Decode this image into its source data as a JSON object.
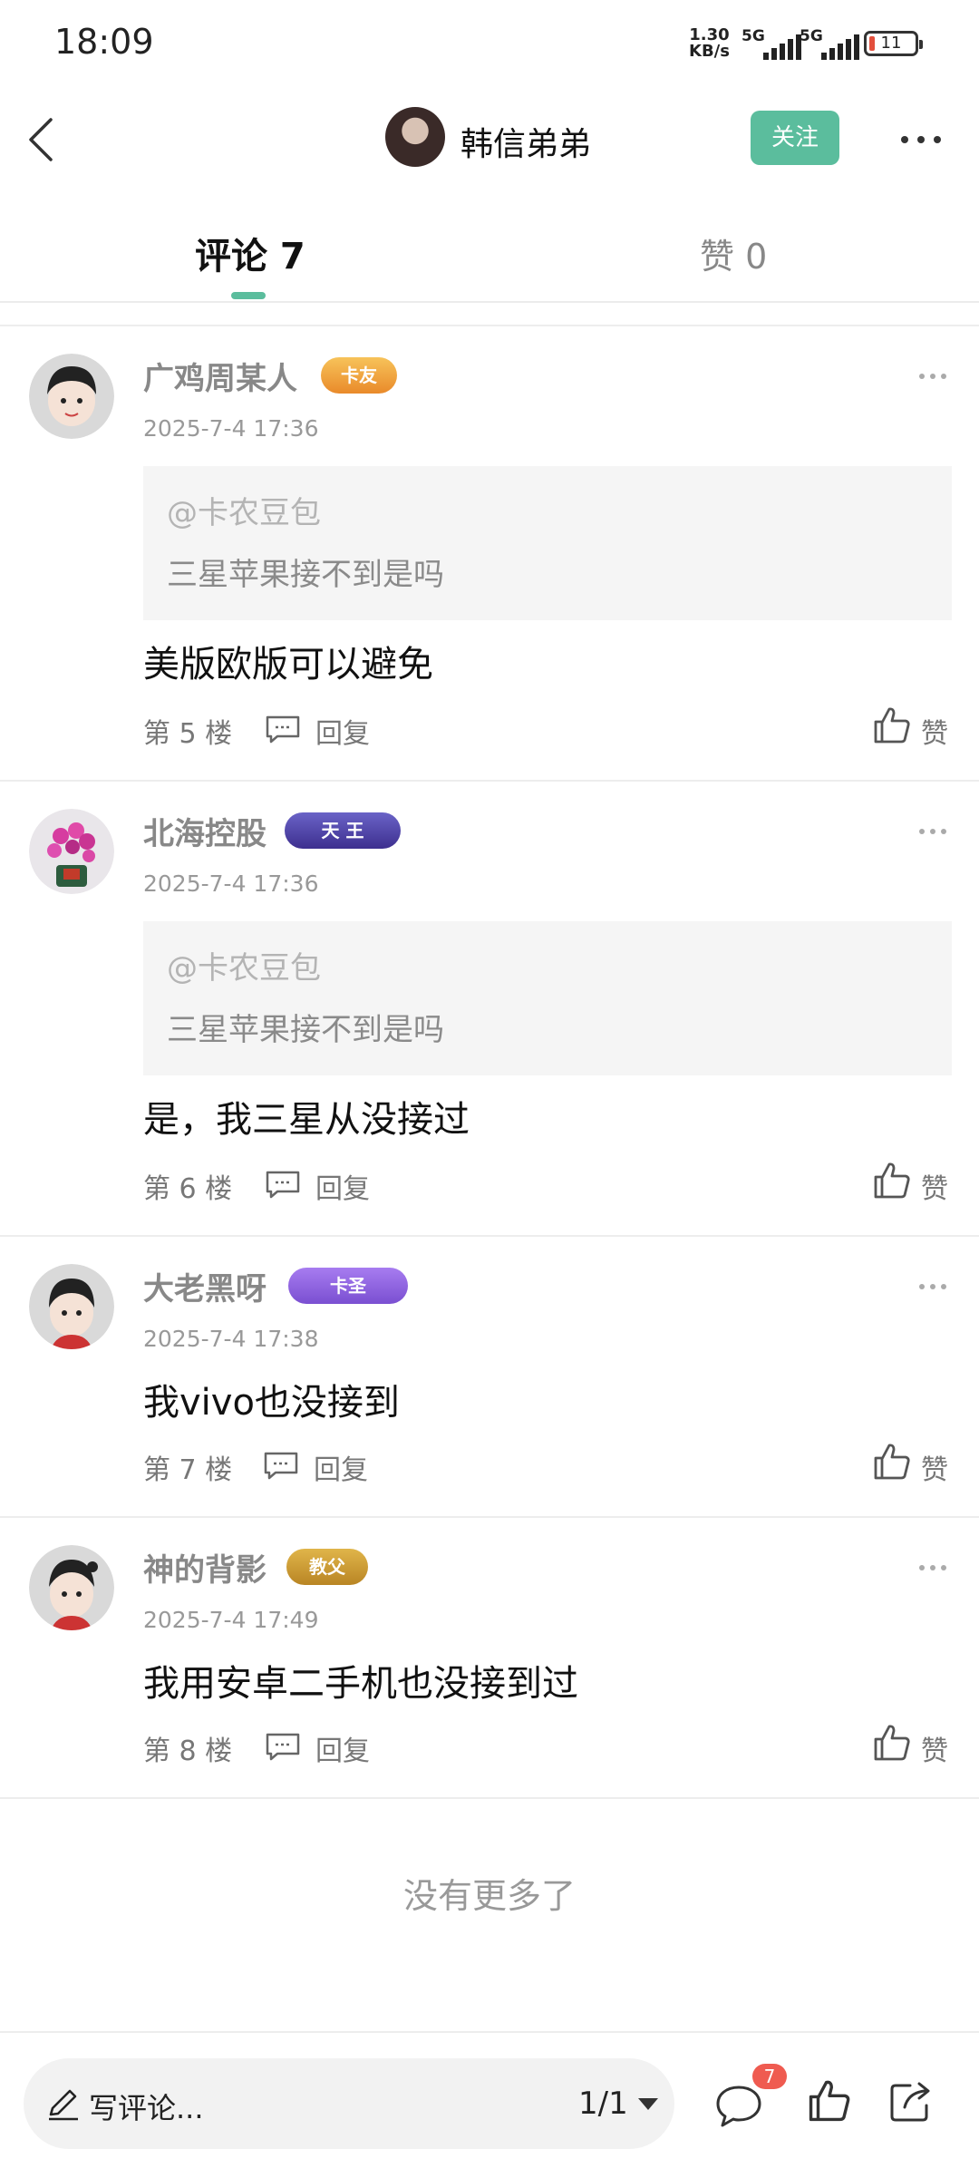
{
  "status": {
    "time": "18:09",
    "speed_top": "1.30",
    "speed_bottom": "KB/s",
    "sig1": "5G",
    "sig2": "5G",
    "battery": "11"
  },
  "header": {
    "username": "韩信弟弟",
    "follow": "关注"
  },
  "tabs": {
    "comments": "评论 7",
    "likes": "赞 0"
  },
  "comments": [
    {
      "name": "广鸡周某人",
      "badge": "卡友",
      "time": "2025-7-4 17:36",
      "quote_user": "@卡农豆包",
      "quote_text": "三星苹果接不到是吗",
      "body": "美版欧版可以避免",
      "floor": "第 5 楼",
      "reply": "回复",
      "like": "赞"
    },
    {
      "name": "北海控股",
      "badge": "天 王",
      "time": "2025-7-4 17:36",
      "quote_user": "@卡农豆包",
      "quote_text": "三星苹果接不到是吗",
      "body": "是，我三星从没接过",
      "floor": "第 6 楼",
      "reply": "回复",
      "like": "赞"
    },
    {
      "name": "大老黑呀",
      "badge": "卡圣",
      "time": "2025-7-4 17:38",
      "body": "我vivo也没接到",
      "floor": "第 7 楼",
      "reply": "回复",
      "like": "赞"
    },
    {
      "name": "神的背影",
      "badge": "教父",
      "time": "2025-7-4 17:49",
      "body": "我用安卓二手机也没接到过",
      "floor": "第 8 楼",
      "reply": "回复",
      "like": "赞"
    }
  ],
  "no_more": "没有更多了",
  "bottom": {
    "placeholder": "写评论...",
    "page": "1/1",
    "comment_count": "7"
  },
  "colors": {
    "accent": "#5bbd9d",
    "badge_red": "#ef5b50"
  }
}
